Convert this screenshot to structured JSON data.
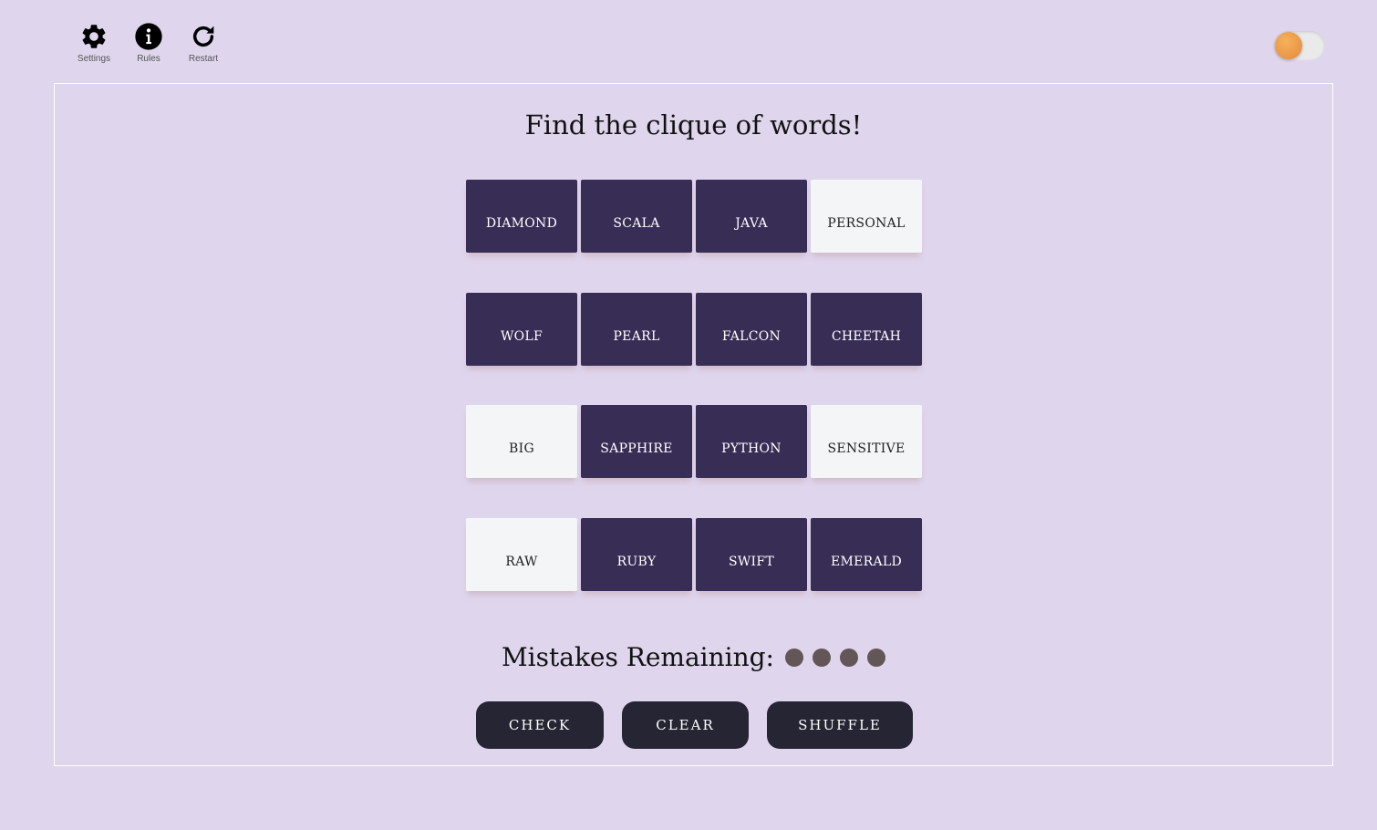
{
  "toolbar": {
    "settings_label": "Settings",
    "rules_label": "Rules",
    "restart_label": "Restart"
  },
  "theme_toggle": {
    "icon": "toggle-switch",
    "knob_color": "#e8923f",
    "on": false
  },
  "title": "Find the clique of words!",
  "tiles": [
    {
      "label": "DIAMOND",
      "state": "dark"
    },
    {
      "label": "SCALA",
      "state": "dark"
    },
    {
      "label": "JAVA",
      "state": "dark"
    },
    {
      "label": "PERSONAL",
      "state": "light"
    },
    {
      "label": "WOLF",
      "state": "dark"
    },
    {
      "label": "PEARL",
      "state": "dark"
    },
    {
      "label": "FALCON",
      "state": "dark"
    },
    {
      "label": "CHEETAH",
      "state": "dark"
    },
    {
      "label": "BIG",
      "state": "light"
    },
    {
      "label": "SAPPHIRE",
      "state": "dark"
    },
    {
      "label": "PYTHON",
      "state": "dark"
    },
    {
      "label": "SENSITIVE",
      "state": "light"
    },
    {
      "label": "RAW",
      "state": "light"
    },
    {
      "label": "RUBY",
      "state": "dark"
    },
    {
      "label": "SWIFT",
      "state": "dark"
    },
    {
      "label": "EMERALD",
      "state": "dark"
    }
  ],
  "mistakes": {
    "label": "Mistakes Remaining:",
    "remaining": 4
  },
  "buttons": {
    "check": "CHECK",
    "clear": "CLEAR",
    "shuffle": "SHUFFLE"
  },
  "colors": {
    "background": "#dfd5ed",
    "tile_dark": "#382d55",
    "tile_light": "#f4f5f7",
    "button": "#252533",
    "mistake_dot": "#625656"
  }
}
